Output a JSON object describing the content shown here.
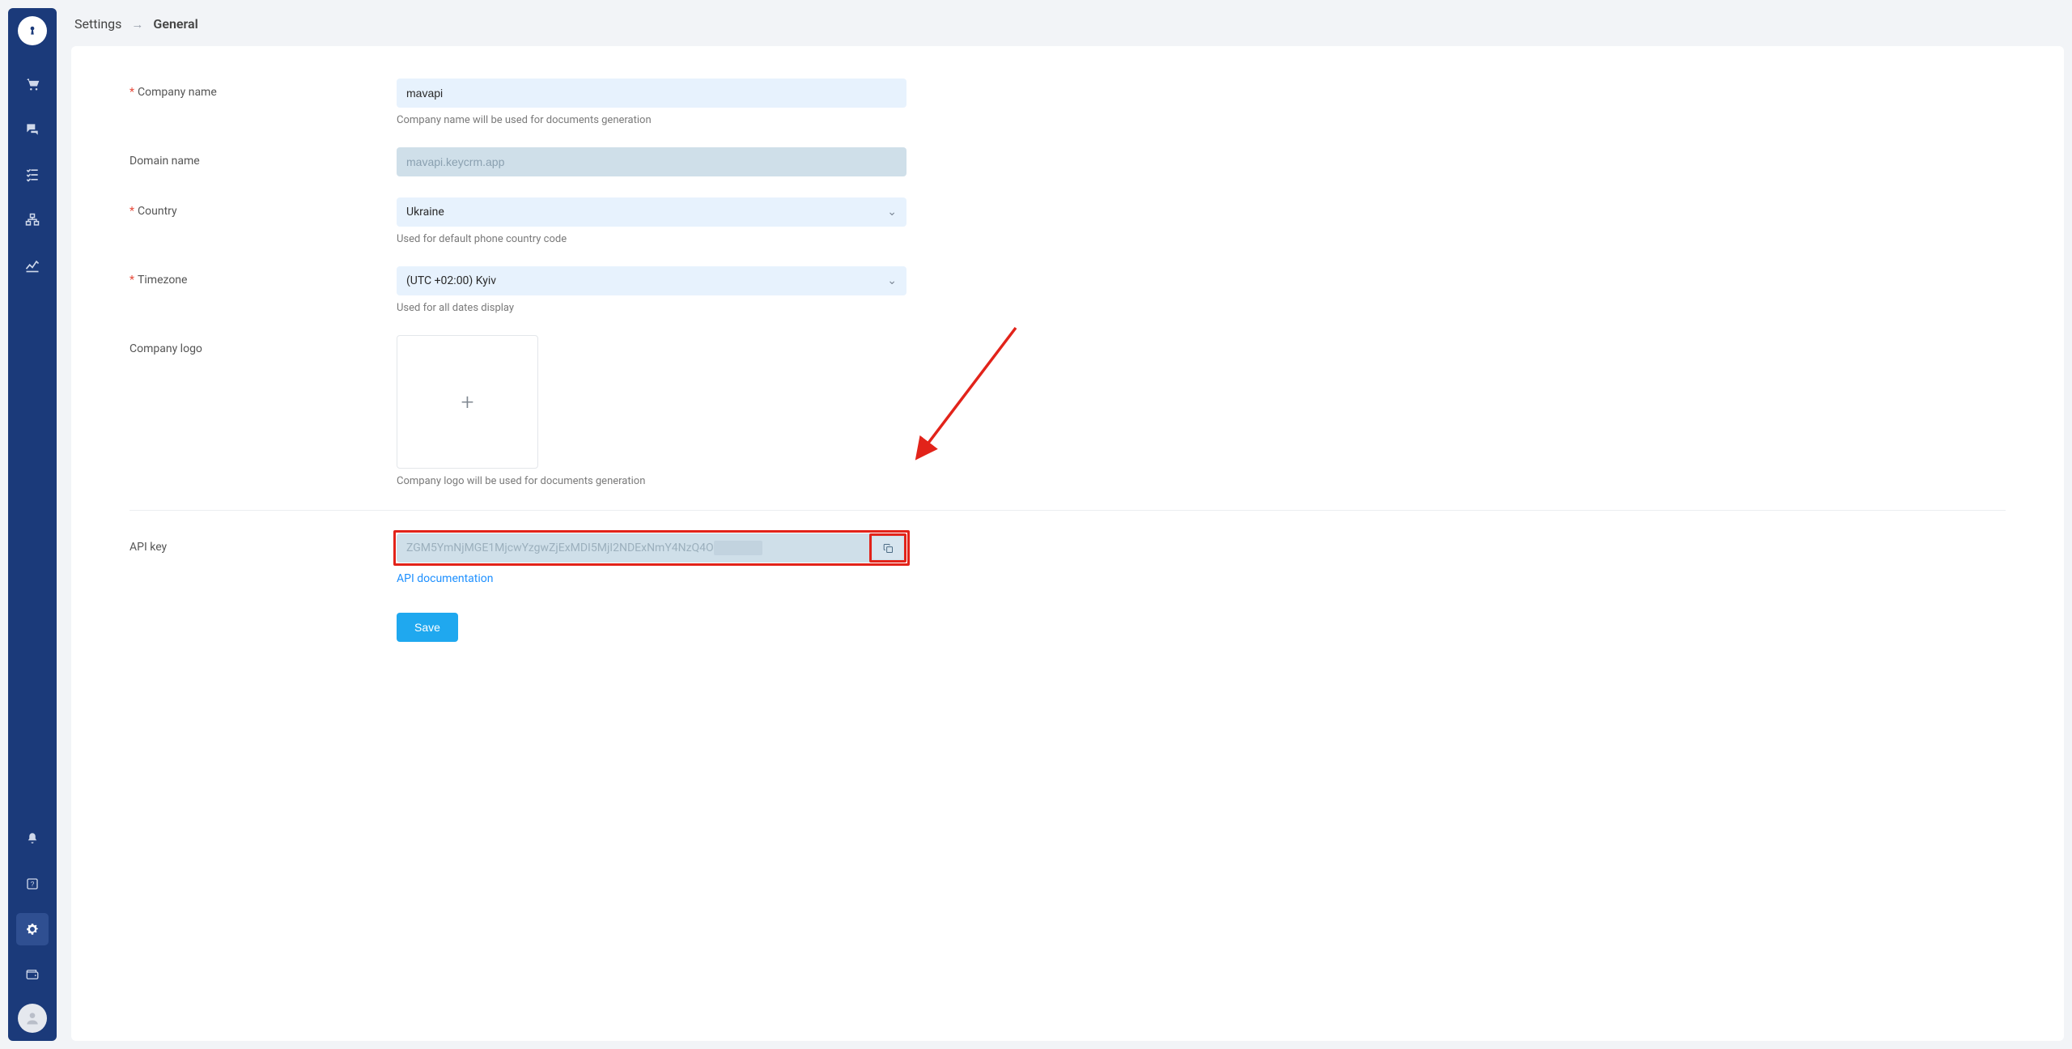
{
  "breadcrumb": {
    "parent": "Settings",
    "current": "General"
  },
  "form": {
    "company_name": {
      "label": "Company name",
      "value": "mavapi",
      "help": "Company name will be used for documents generation",
      "required": true
    },
    "domain_name": {
      "label": "Domain name",
      "value": "mavapi.keycrm.app",
      "required": false
    },
    "country": {
      "label": "Country",
      "value": "Ukraine",
      "help": "Used for default phone country code",
      "required": true
    },
    "timezone": {
      "label": "Timezone",
      "value": "(UTC +02:00) Kyiv",
      "help": "Used for all dates display",
      "required": true
    },
    "company_logo": {
      "label": "Company logo",
      "help": "Company logo will be used for documents generation"
    },
    "api_key": {
      "label": "API key",
      "value": "ZGM5YmNjMGE1MjcwYzgwZjExMDI5MjI2NDExNmY4NzQ4OGE",
      "doc_link": "API documentation"
    },
    "save_label": "Save"
  },
  "sidebar": {
    "top_icons": [
      "cart-icon",
      "chat-icon",
      "checklist-icon",
      "org-icon",
      "analytics-icon"
    ],
    "bottom_icons": [
      "bell-icon",
      "help-icon",
      "settings-icon",
      "wallet-icon"
    ]
  }
}
